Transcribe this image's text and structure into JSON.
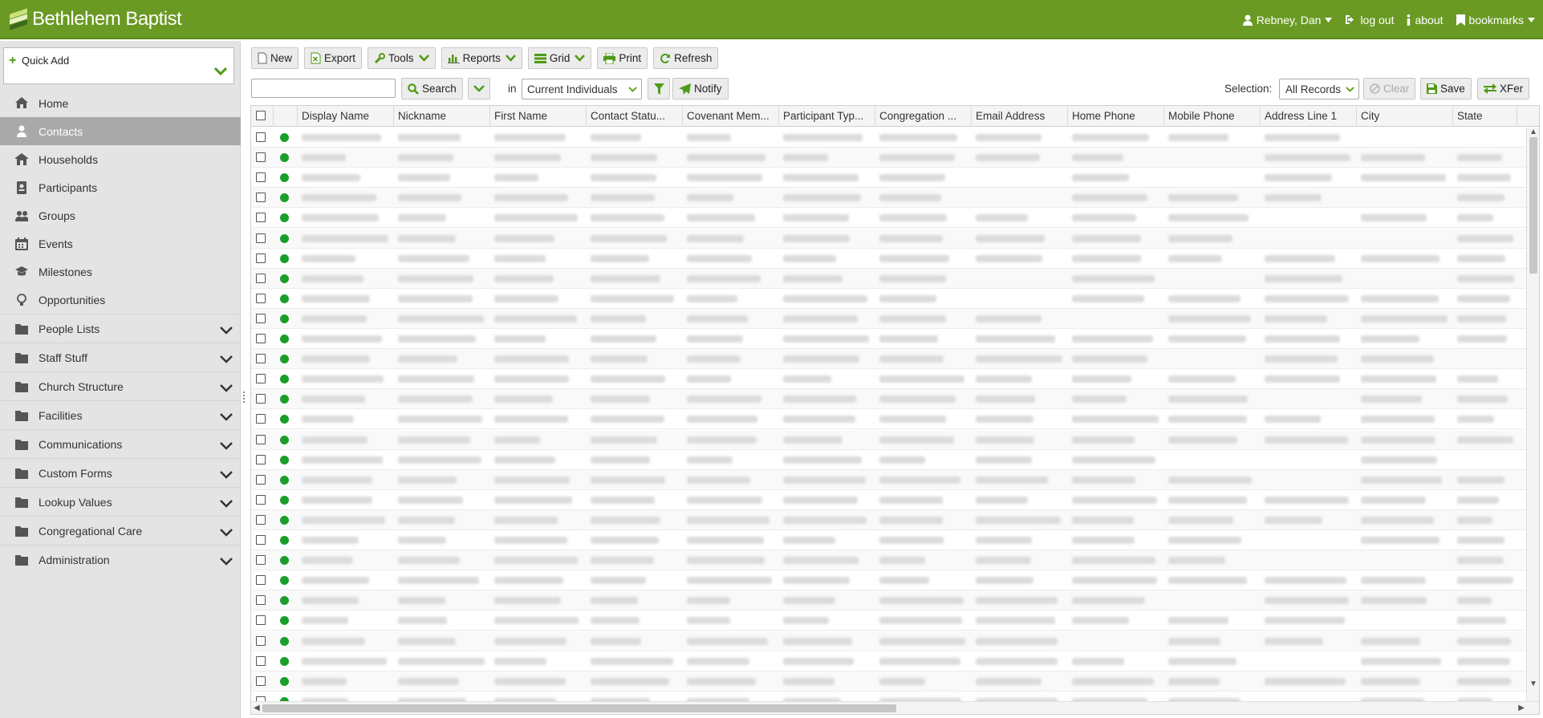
{
  "app": {
    "title": "Bethlehem Baptist",
    "colors": {
      "header": "#6a9a24",
      "accent": "#4f9a16",
      "sidebar": "#e4e4e4",
      "sidebar_active": "#a9a9a9",
      "status_active": "#1a9e2a"
    }
  },
  "top_nav": {
    "user_label": "Rebney, Dan",
    "user_icon": "user-icon",
    "logout_label": "log out",
    "logout_icon": "sign-out-icon",
    "about_label": "about",
    "about_icon": "info-icon",
    "bookmarks_label": "bookmarks",
    "bookmarks_icon": "bookmark-icon"
  },
  "sidebar": {
    "quick_add_label": "Quick Add",
    "items": [
      {
        "label": "Home",
        "icon": "home-icon",
        "active": false,
        "folder": false
      },
      {
        "label": "Contacts",
        "icon": "user-icon",
        "active": true,
        "folder": false
      },
      {
        "label": "Households",
        "icon": "house-icon",
        "active": false,
        "folder": false
      },
      {
        "label": "Participants",
        "icon": "id-badge-icon",
        "active": false,
        "folder": false
      },
      {
        "label": "Groups",
        "icon": "users-icon",
        "active": false,
        "folder": false
      },
      {
        "label": "Events",
        "icon": "calendar-icon",
        "active": false,
        "folder": false
      },
      {
        "label": "Milestones",
        "icon": "graduation-cap-icon",
        "active": false,
        "folder": false
      },
      {
        "label": "Opportunities",
        "icon": "lightbulb-icon",
        "active": false,
        "folder": false
      },
      {
        "label": "People Lists",
        "icon": "folder-icon",
        "active": false,
        "folder": true
      },
      {
        "label": "Staff Stuff",
        "icon": "folder-icon",
        "active": false,
        "folder": true
      },
      {
        "label": "Church Structure",
        "icon": "folder-icon",
        "active": false,
        "folder": true
      },
      {
        "label": "Facilities",
        "icon": "folder-icon",
        "active": false,
        "folder": true
      },
      {
        "label": "Communications",
        "icon": "folder-icon",
        "active": false,
        "folder": true
      },
      {
        "label": "Custom Forms",
        "icon": "folder-icon",
        "active": false,
        "folder": true
      },
      {
        "label": "Lookup Values",
        "icon": "folder-icon",
        "active": false,
        "folder": true
      },
      {
        "label": "Congregational Care",
        "icon": "folder-icon",
        "active": false,
        "folder": true
      },
      {
        "label": "Administration",
        "icon": "folder-icon",
        "active": false,
        "folder": true
      }
    ]
  },
  "toolbar": {
    "new_label": "New",
    "export_label": "Export",
    "tools_label": "Tools",
    "reports_label": "Reports",
    "grid_label": "Grid",
    "print_label": "Print",
    "refresh_label": "Refresh"
  },
  "search": {
    "value": "",
    "button_label": "Search",
    "in_label": "in",
    "scope_value": "Current Individuals",
    "notify_label": "Notify",
    "selection_label": "Selection:",
    "selection_value": "All Records",
    "clear_label": "Clear",
    "save_label": "Save",
    "xfer_label": "XFer"
  },
  "grid": {
    "columns": [
      "Display Name",
      "Nickname",
      "First Name",
      "Contact Statu...",
      "Covenant Mem...",
      "Participant Typ...",
      "Congregation ...",
      "Email Address",
      "Home Phone",
      "Mobile Phone",
      "Address Line 1",
      "City",
      "State"
    ],
    "row_count": 29,
    "row_status": "active",
    "redacted_note": ""
  }
}
